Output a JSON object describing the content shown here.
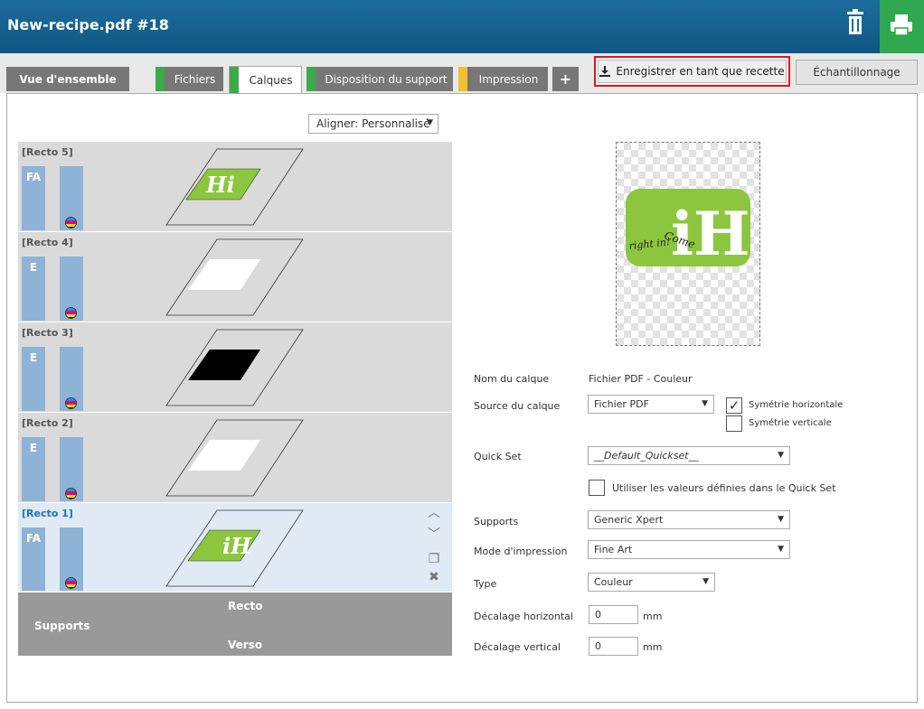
{
  "header": {
    "title": "New-recipe.pdf #18"
  },
  "tabs": [
    {
      "label": "Vue d'ensemble"
    },
    {
      "label": "Fichiers",
      "color": "#3aaa4a"
    },
    {
      "label": "Calques",
      "color": "#3aaa4a"
    },
    {
      "label": "Disposition du support",
      "color": "#3aaa4a"
    },
    {
      "label": "Impression",
      "color": "#f0c030"
    },
    {
      "label": "+"
    }
  ],
  "toolbar": {
    "save_recipe_label": "Enregistrer en tant que recette",
    "sampling_label": "Échantillonnage"
  },
  "align": {
    "value": "Aligner: Personnalisé"
  },
  "layers": [
    {
      "name": "[Recto 5]",
      "badge": "FA"
    },
    {
      "name": "[Recto 4]",
      "badge": "E"
    },
    {
      "name": "[Recto 3]",
      "badge": "E"
    },
    {
      "name": "[Recto 2]",
      "badge": "E"
    },
    {
      "name": "[Recto 1]",
      "badge": "FA"
    }
  ],
  "supports_table": {
    "label": "Supports",
    "recto": "Recto",
    "verso": "Verso"
  },
  "preview": {
    "logo_text": "iH",
    "script_line1": "Come",
    "script_line2": "right in!"
  },
  "thumb_text": {
    "hi": "Hi",
    "ih": "iH"
  },
  "form": {
    "layer_name_label": "Nom du calque",
    "layer_name_value": "Fichier PDF - Couleur",
    "layer_source_label": "Source du calque",
    "layer_source_value": "Fichier PDF",
    "flip_h_label": "Symétrie horizontale",
    "flip_v_label": "Symétrie verticale",
    "quickset_label": "Quick Set",
    "quickset_value": "__Default_Quickset__",
    "use_quickset_label": "Utiliser les valeurs définies dans le Quick Set",
    "supports_label": "Supports",
    "supports_value": "Generic Xpert",
    "print_mode_label": "Mode d'impression",
    "print_mode_value": "Fine Art",
    "type_label": "Type",
    "type_value": "Couleur",
    "h_offset_label": "Décalage horizontal",
    "h_offset_value": "0",
    "v_offset_label": "Décalage vertical",
    "v_offset_value": "0",
    "unit": "mm"
  },
  "colors": {
    "accent_green": "#2fa84f",
    "header_blue": "#0f5683",
    "highlight_red": "#e8101c",
    "logo_green": "#8cc63f"
  }
}
